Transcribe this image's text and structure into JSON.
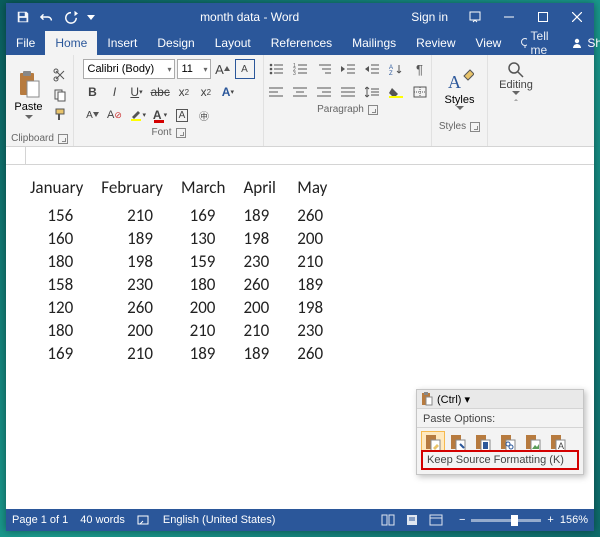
{
  "titlebar": {
    "title": "month data - Word",
    "signin": "Sign in"
  },
  "tabs": {
    "file": "File",
    "home": "Home",
    "insert": "Insert",
    "design": "Design",
    "layout": "Layout",
    "references": "References",
    "mailings": "Mailings",
    "review": "Review",
    "view": "View",
    "tellme": "Tell me",
    "share": "Share"
  },
  "ribbon": {
    "clipboard": {
      "label": "Clipboard",
      "paste": "Paste"
    },
    "font": {
      "label": "Font",
      "font_name": "Calibri (Body)",
      "font_size": "11"
    },
    "paragraph": {
      "label": "Paragraph"
    },
    "styles": {
      "label": "Styles",
      "button": "Styles"
    },
    "editing": {
      "label": "Editing"
    }
  },
  "table": {
    "headers": [
      "January",
      "February",
      "March",
      "April",
      "May"
    ],
    "rows": [
      [
        156,
        210,
        169,
        189,
        260
      ],
      [
        160,
        189,
        130,
        198,
        200
      ],
      [
        180,
        198,
        159,
        230,
        210
      ],
      [
        158,
        230,
        180,
        260,
        189
      ],
      [
        120,
        260,
        200,
        200,
        198
      ],
      [
        180,
        200,
        210,
        210,
        230
      ],
      [
        169,
        210,
        189,
        189,
        260
      ]
    ]
  },
  "paste_popup": {
    "handle": "(Ctrl) ▾",
    "title": "Paste Options:",
    "tooltip": "Keep Source Formatting (K)"
  },
  "status": {
    "page": "Page 1 of 1",
    "words": "40 words",
    "lang": "English (United States)",
    "zoom": "156%"
  }
}
